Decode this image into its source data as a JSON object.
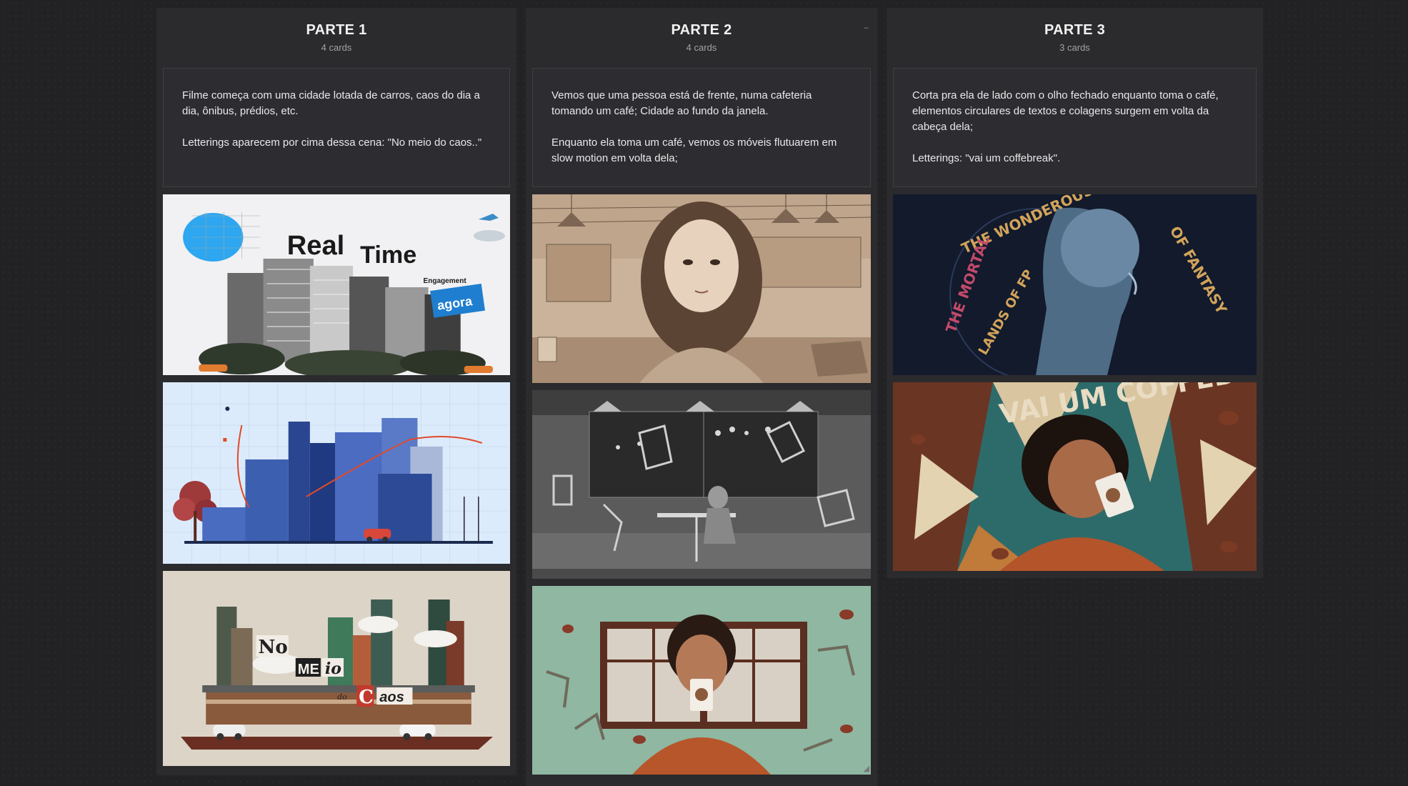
{
  "columns": [
    {
      "title": "PARTE 1",
      "count": "4 cards",
      "text": [
        "Filme começa com uma cidade lotada de carros, caos do dia a dia, ônibus, prédios, etc.",
        "Letterings aparecem por cima dessa cena: \"No meio do caos..\""
      ],
      "images": [
        {
          "icon": "collage-city-image",
          "caption": [
            "Real",
            "Time",
            "Engagement",
            "agora"
          ]
        },
        {
          "icon": "blue-skyscrapers-image"
        },
        {
          "icon": "chaos-collage-image",
          "caption": [
            "No",
            "ME",
            "io",
            "do",
            "C",
            "aos"
          ]
        }
      ]
    },
    {
      "title": "PARTE 2",
      "count": "4 cards",
      "menu": "–",
      "text": [
        "Vemos que uma pessoa está de frente, numa cafeteria tomando um café; Cidade ao fundo da janela.",
        "Enquanto ela toma um café, vemos os móveis flutuarem em slow motion em volta dela;"
      ],
      "images": [
        {
          "icon": "cafe-sketch-girl-image"
        },
        {
          "icon": "floating-chairs-sketch-image"
        },
        {
          "icon": "coffee-girl-green-image"
        }
      ]
    },
    {
      "title": "PARTE 3",
      "count": "3 cards",
      "text": [
        "Corta pra ela de lado com o olho fechado enquanto toma o café, elementos circulares de textos e colagens surgem em volta da cabeça dela;",
        "Letterings: \"vai um coffebreak\"."
      ],
      "images": [
        {
          "icon": "typography-profile-image",
          "caption": [
            "THE WONDEROUS",
            "OF FANTASY",
            "THE MORTAL",
            "LANDS OF FP"
          ]
        },
        {
          "icon": "coffebreak-collage-image",
          "caption": [
            "VAI UM COFFEBREAK"
          ]
        }
      ]
    }
  ]
}
